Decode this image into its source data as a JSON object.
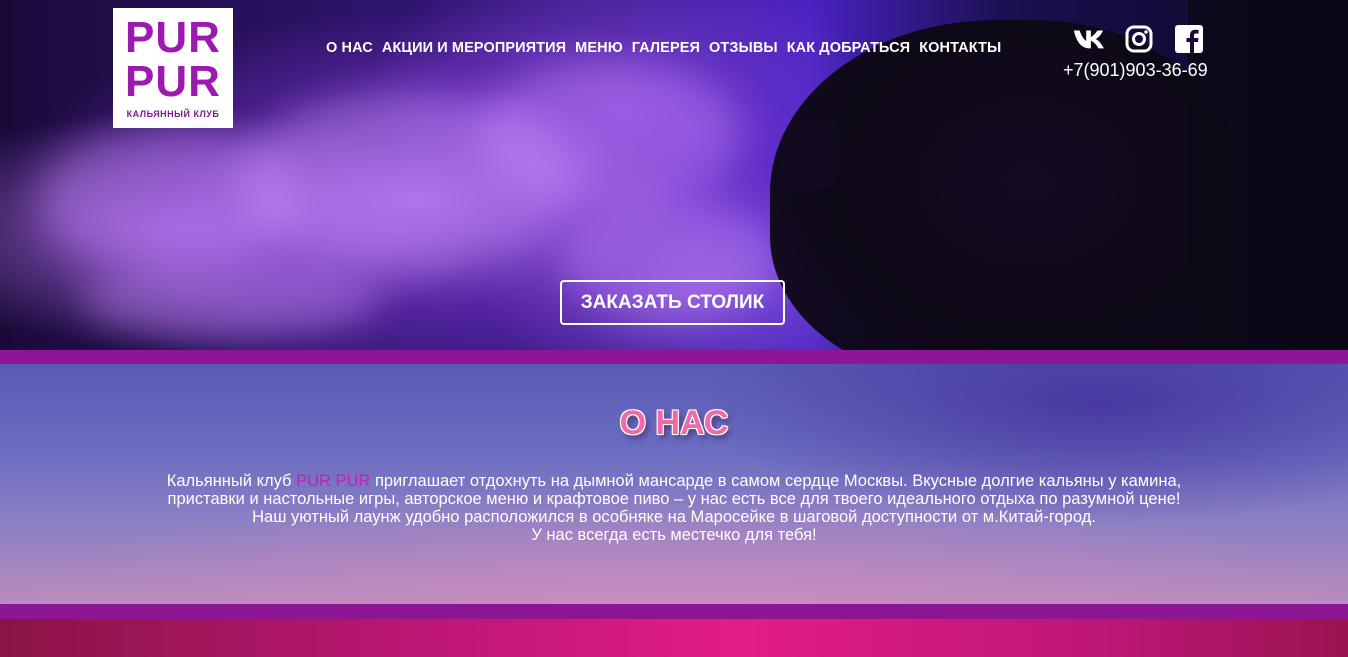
{
  "logo": {
    "line1": "PUR",
    "line2": "PUR",
    "subtitle": "КАЛЬЯННЫЙ КЛУБ"
  },
  "nav": {
    "items": [
      {
        "label": "О НАС"
      },
      {
        "label": "АКЦИИ И МЕРОПРИЯТИЯ"
      },
      {
        "label": "МЕНЮ"
      },
      {
        "label": "ГАЛЕРЕЯ"
      },
      {
        "label": "ОТЗЫВЫ"
      },
      {
        "label": "КАК ДОБРАТЬСЯ"
      },
      {
        "label": "КОНТАКТЫ"
      }
    ]
  },
  "social": {
    "icons": [
      "vk-icon",
      "instagram-icon",
      "facebook-icon"
    ],
    "phone": "+7(901)903-36-69"
  },
  "hero": {
    "button_label": "ЗАКАЗАТЬ СТОЛИК"
  },
  "about": {
    "title": "О НАС",
    "text_prefix": "Кальянный клуб ",
    "brand": "PUR PUR",
    "text_line1_rest": " приглашает отдохнуть на дымной мансарде в самом сердце Москвы. Вкусные долгие кальяны у камина,",
    "text_line2": "приставки и настольные игры, авторское меню и крафтовое пиво – у нас есть все для твоего идеального отдыха по разумной цене!",
    "text_line3": "Наш уютный лаунж удобно расположился в особняке на Маросейке в шаговой доступности от м.Китай-город.",
    "text_line4": "У нас всегда есть местечко для тебя!"
  },
  "colors": {
    "brand_purple": "#9c1ab0",
    "stripe": "#8c1694",
    "title_pink": "#f06aa8",
    "footer_pink": "#e21d86"
  }
}
